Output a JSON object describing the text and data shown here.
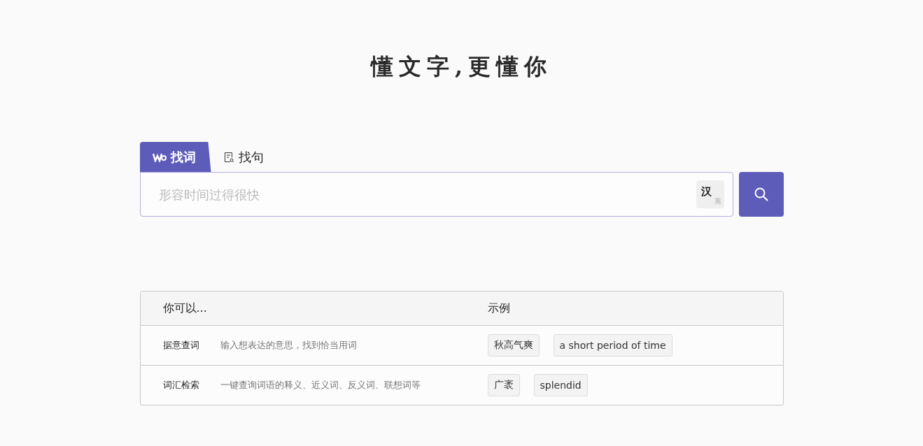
{
  "slogan": "懂文字,更懂你",
  "tabs": [
    {
      "label": "找词",
      "kind": "word",
      "selected": true
    },
    {
      "label": "找句",
      "kind": "sentence",
      "selected": false
    }
  ],
  "search": {
    "placeholder": "形容时间过得很快",
    "lang_toggle": {
      "primary": "汉",
      "secondary": "英"
    }
  },
  "table": {
    "columns": [
      "你可以...",
      "示例"
    ],
    "rows": [
      {
        "feature": "据意查词",
        "description": "输入想表达的意思，找到恰当用词",
        "examples": [
          "秋高气爽",
          "a short period of time"
        ]
      },
      {
        "feature": "词汇检索",
        "description": "一键查询词语的释义、近义词、反义词、联想词等",
        "examples": [
          "广袤",
          "splendid"
        ]
      }
    ]
  }
}
